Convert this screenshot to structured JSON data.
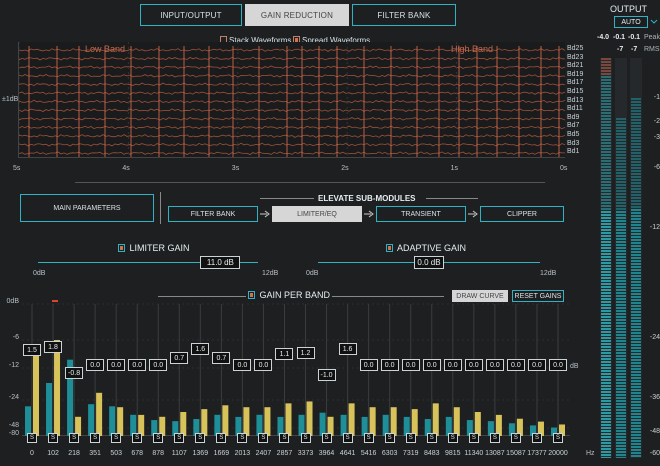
{
  "tabs": [
    {
      "label": "INPUT/OUTPUT",
      "active": false
    },
    {
      "label": "GAIN REDUCTION",
      "active": true
    },
    {
      "label": "FILTER BANK",
      "active": false
    }
  ],
  "waveform": {
    "stack_label": "Stack Waveforms",
    "spread_label": "Spread Waveforms",
    "low_band": "Low Band",
    "high_band": "High Band",
    "ylabel": "±1dB",
    "band_labels": [
      "Bd25",
      "Bd23",
      "Bd21",
      "Bd19",
      "Bd17",
      "Bd15",
      "Bd13",
      "Bd11",
      "Bd9",
      "Bd7",
      "Bd5",
      "Bd3",
      "Bd1"
    ],
    "time_ticks": [
      "5s",
      "4s",
      "3s",
      "2s",
      "1s",
      "0s"
    ],
    "colors": {
      "wave": "#b85a3c",
      "accent": "#e07050"
    }
  },
  "modules": {
    "main_params": "MAIN PARAMETERS",
    "title": "ELEVATE SUB-MODULES",
    "items": [
      {
        "label": "FILTER BANK",
        "active": false
      },
      {
        "label": "LIMITER/EQ",
        "active": true
      },
      {
        "label": "TRANSIENT",
        "active": false
      },
      {
        "label": "CLIPPER",
        "active": false
      }
    ]
  },
  "limiter": {
    "label": "LIMITER GAIN",
    "value": "11.0 dB",
    "min": "0dB",
    "max": "12dB",
    "fraction": 0.92
  },
  "adaptive": {
    "label": "ADAPTIVE GAIN",
    "value": "0.0 dB",
    "min": "0dB",
    "max": "12dB",
    "fraction": 0.5
  },
  "gain_per_band": {
    "title": "GAIN PER BAND",
    "draw_curve": "DRAW CURVE",
    "reset_gains": "RESET GAINS",
    "y_ticks": [
      "0dB",
      "-6",
      "-12",
      "-24",
      "-48",
      "-80"
    ],
    "unit_db": "dB",
    "unit_hz": "Hz",
    "bands": [
      {
        "hz": "0",
        "gain": "1.5",
        "s": "S"
      },
      {
        "hz": "102",
        "gain": "1.8",
        "s": "S"
      },
      {
        "hz": "218",
        "gain": "-0.8",
        "s": "S"
      },
      {
        "hz": "351",
        "gain": "0.0",
        "s": "S"
      },
      {
        "hz": "503",
        "gain": "0.0",
        "s": "S"
      },
      {
        "hz": "678",
        "gain": "0.0",
        "s": "S"
      },
      {
        "hz": "878",
        "gain": "0.0",
        "s": "S"
      },
      {
        "hz": "1107",
        "gain": "0.7",
        "s": "S"
      },
      {
        "hz": "1369",
        "gain": "1.6",
        "s": "S"
      },
      {
        "hz": "1669",
        "gain": "0.7",
        "s": "S"
      },
      {
        "hz": "2013",
        "gain": "0.0",
        "s": "S"
      },
      {
        "hz": "2407",
        "gain": "0.0",
        "s": "S"
      },
      {
        "hz": "2857",
        "gain": "1.1",
        "s": "S"
      },
      {
        "hz": "3373",
        "gain": "1.2",
        "s": "S"
      },
      {
        "hz": "3964",
        "gain": "-1.0",
        "s": "S"
      },
      {
        "hz": "4641",
        "gain": "1.6",
        "s": "S"
      },
      {
        "hz": "5416",
        "gain": "0.0",
        "s": "S"
      },
      {
        "hz": "6303",
        "gain": "0.0",
        "s": "S"
      },
      {
        "hz": "7319",
        "gain": "0.0",
        "s": "S"
      },
      {
        "hz": "8483",
        "gain": "0.0",
        "s": "S"
      },
      {
        "hz": "9815",
        "gain": "0.0",
        "s": "S"
      },
      {
        "hz": "11340",
        "gain": "0.0",
        "s": "S"
      },
      {
        "hz": "13087",
        "gain": "0.0",
        "s": "S"
      },
      {
        "hz": "15087",
        "gain": "0.0",
        "s": "S"
      },
      {
        "hz": "17377",
        "gain": "0.0",
        "s": "S"
      },
      {
        "hz": "20000",
        "gain": "0.0",
        "s": "S"
      }
    ],
    "teal_levels": [
      0.28,
      0.5,
      0.72,
      0.3,
      0.28,
      0.2,
      0.15,
      0.14,
      0.16,
      0.2,
      0.18,
      0.2,
      0.18,
      0.2,
      0.22,
      0.2,
      0.18,
      0.2,
      0.18,
      0.16,
      0.18,
      0.15,
      0.14,
      0.12,
      0.1,
      0.08
    ],
    "yellow_levels": [
      0.9,
      1.0,
      0.2,
      0.45,
      0.3,
      0.22,
      0.2,
      0.25,
      0.28,
      0.32,
      0.3,
      0.3,
      0.34,
      0.36,
      0.2,
      0.34,
      0.3,
      0.3,
      0.28,
      0.34,
      0.3,
      0.25,
      0.22,
      0.18,
      0.15,
      0.12
    ],
    "colors": {
      "teal": "#1e8f99",
      "yellow": "#d8c25a"
    }
  },
  "output": {
    "title": "OUTPUT",
    "mode": "AUTO",
    "peak_values": [
      "-4.0",
      "-0.1",
      "-0.1"
    ],
    "peak_label": "Peak",
    "rms_values": [
      "-7",
      "-7"
    ],
    "rms_label": "RMS",
    "scale": [
      "-1",
      "-2",
      "-3",
      "-6",
      "-12",
      "-24",
      "-36",
      "-48",
      "-60"
    ]
  }
}
